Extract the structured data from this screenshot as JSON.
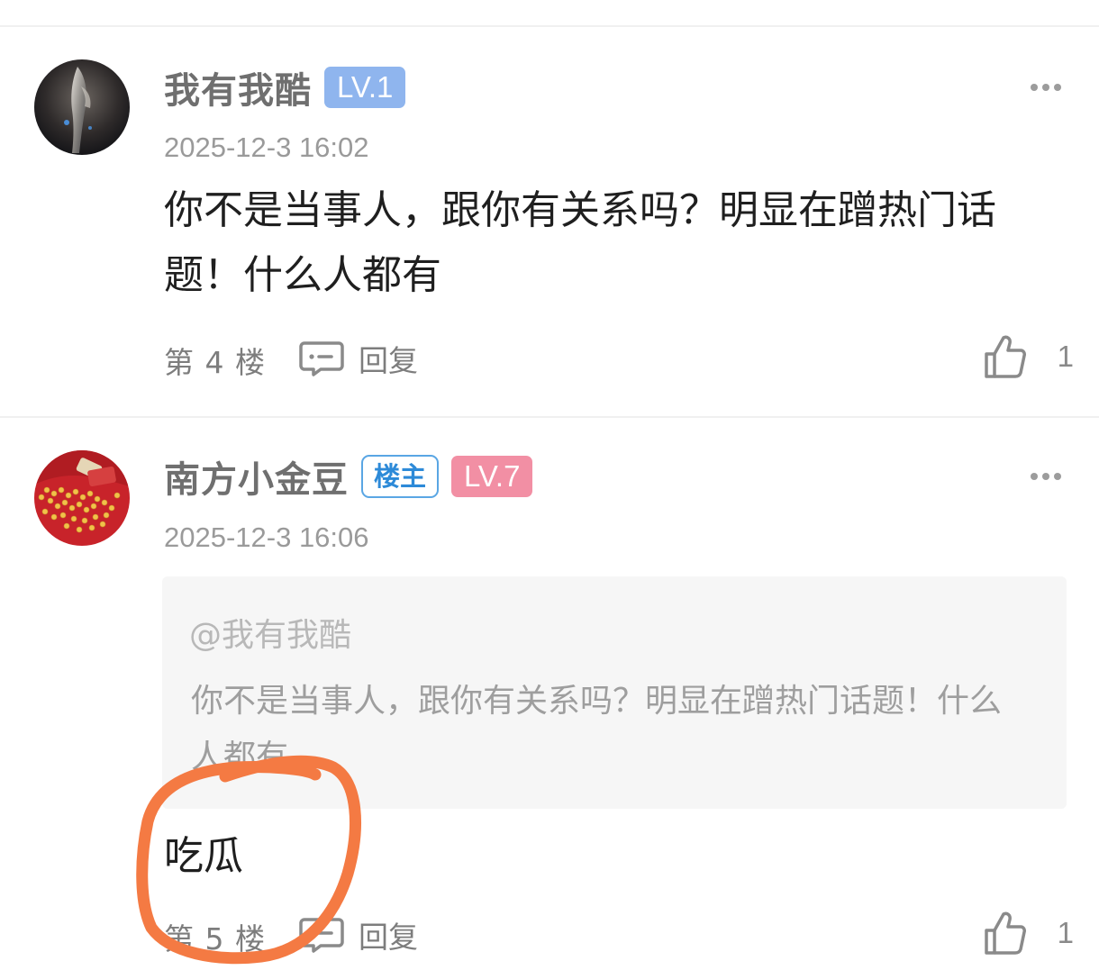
{
  "comments": [
    {
      "username": "我有我酷",
      "level": "LV.1",
      "timestamp": "2025-12-3 16:02",
      "content": "你不是当事人，跟你有关系吗？明显在蹭热门话题！什么人都有",
      "floor": "第 4 楼",
      "reply_label": "回复",
      "likes": "1"
    },
    {
      "username": "南方小金豆",
      "owner_badge": "楼主",
      "level": "LV.7",
      "timestamp": "2025-12-3 16:06",
      "quote": {
        "user": "@我有我酷",
        "text": "你不是当事人，跟你有关系吗？明显在蹭热门话题！什么人都有"
      },
      "content": "吃瓜",
      "floor": "第 5 楼",
      "reply_label": "回复",
      "likes": "1"
    }
  ],
  "colors": {
    "level1_badge": "#8fb5ee",
    "level7_badge": "#f28fa4",
    "annotation_circle": "#f47a43"
  },
  "icons": {
    "more": "more-dots-icon",
    "reply": "comment-bubble-icon",
    "like": "thumbs-up-icon"
  }
}
